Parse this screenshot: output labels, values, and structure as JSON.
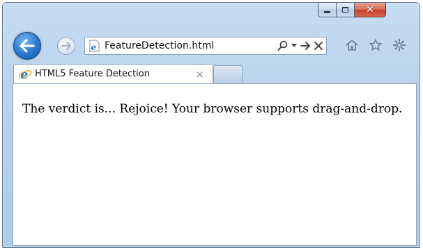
{
  "address_bar": {
    "url": "FeatureDetection.html"
  },
  "tab": {
    "title": "HTML5 Feature Detection",
    "close_glyph": "×"
  },
  "content": {
    "message": "The verdict is... Rejoice! Your browser supports drag-and-drop."
  },
  "icons": {
    "back": "back-arrow-icon",
    "forward": "forward-arrow-icon",
    "page": "ie-page-icon",
    "search": "search-icon",
    "dropdown": "dropdown-icon",
    "go": "go-arrow-icon",
    "stop": "stop-icon",
    "home": "home-icon",
    "favorites": "star-icon",
    "tools": "gear-icon"
  },
  "colors": {
    "frame": "#b9d1ec",
    "ie_blue": "#2a78cf",
    "close_red": "#c4412a"
  }
}
